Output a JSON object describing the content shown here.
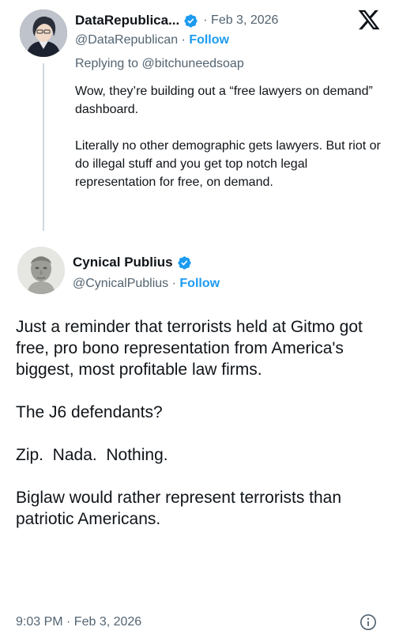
{
  "reply_tweet": {
    "display_name": "DataRepublica...",
    "date": "· Feb 3, 2026",
    "handle": "@DataRepublican",
    "separator": " · ",
    "follow_label": "Follow",
    "replying_to": "Replying to @bitchuneedsoap",
    "paragraphs": [
      "Wow, they’re building out a “free lawyers on demand” dashboard.",
      "Literally no other demographic gets lawyers. But riot or do illegal stuff and you get top notch legal representation for free, on demand."
    ]
  },
  "main_tweet": {
    "display_name": "Cynical Publius",
    "handle": "@CynicalPublius",
    "separator": " · ",
    "follow_label": "Follow",
    "paragraphs": [
      "Just a reminder that terrorists held at Gitmo got free, pro bono representation from America's biggest, most profitable law firms.",
      "The J6 defendants?",
      "Zip.  Nada.  Nothing.",
      "Biglaw would rather represent terrorists than patriotic Americans."
    ],
    "timestamp": "9:03 PM · Feb 3, 2026"
  },
  "icons": {
    "verified": "verified-badge-icon",
    "platform": "x-logo-icon",
    "info": "info-icon"
  },
  "colors": {
    "accent": "#1d9bf0",
    "text": "#0f1419",
    "muted": "#536471",
    "thread_line": "#cfd9de"
  }
}
